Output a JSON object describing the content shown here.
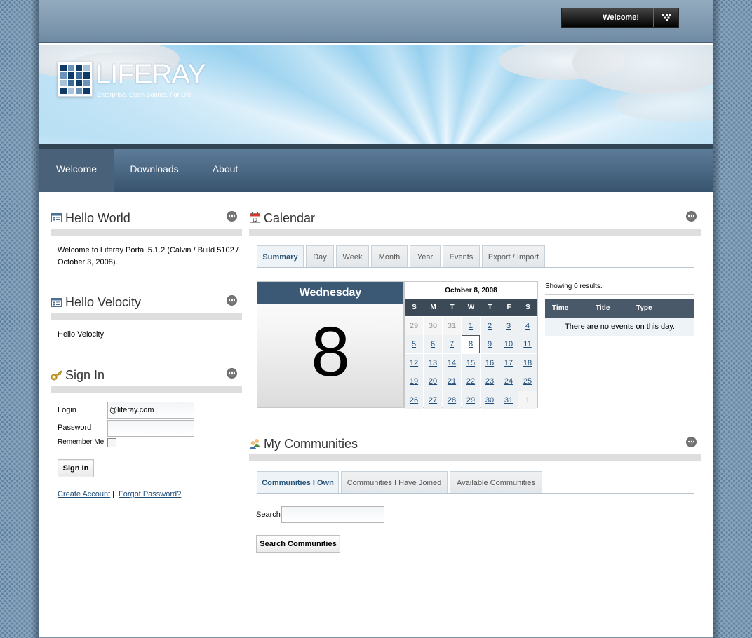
{
  "dock": {
    "welcome": "Welcome!"
  },
  "banner": {
    "logo_text": "LIFERAY",
    "tagline": "Enterprise. Open Source. For Life."
  },
  "nav": {
    "items": [
      "Welcome",
      "Downloads",
      "About"
    ],
    "selected": "Welcome"
  },
  "hello_world": {
    "title": "Hello World",
    "body": "Welcome to Liferay Portal 5.1.2 (Calvin / Build 5102 / October 3, 2008)."
  },
  "hello_velocity": {
    "title": "Hello Velocity",
    "body": "Hello Velocity"
  },
  "sign_in": {
    "title": "Sign In",
    "login_label": "Login",
    "login_value": "@liferay.com",
    "password_label": "Password",
    "password_value": "",
    "remember_label": "Remember Me",
    "remember_checked": false,
    "button": "Sign In",
    "create_account": "Create Account",
    "separator": "|",
    "forgot_password": "Forgot Password?"
  },
  "calendar": {
    "title": "Calendar",
    "tabs": [
      "Summary",
      "Day",
      "Week",
      "Month",
      "Year",
      "Events",
      "Export / Import"
    ],
    "active_tab": "Summary",
    "weekday": "Wednesday",
    "day_number": "8",
    "month_title": "October 8, 2008",
    "weekday_headers": [
      "S",
      "M",
      "T",
      "W",
      "T",
      "F",
      "S"
    ],
    "weeks": [
      [
        "29",
        "30",
        "31",
        "1",
        "2",
        "3",
        "4"
      ],
      [
        "5",
        "6",
        "7",
        "8",
        "9",
        "10",
        "11"
      ],
      [
        "12",
        "13",
        "14",
        "15",
        "16",
        "17",
        "18"
      ],
      [
        "19",
        "20",
        "21",
        "22",
        "23",
        "24",
        "25"
      ],
      [
        "26",
        "27",
        "28",
        "29",
        "30",
        "31",
        "1"
      ]
    ],
    "today": "8",
    "results": "Showing 0 results.",
    "columns": [
      "Time",
      "Title",
      "Type"
    ],
    "empty_message": "There are no events on this day."
  },
  "communities": {
    "title": "My Communities",
    "tabs": [
      "Communities I Own",
      "Communities I Have Joined",
      "Available Communities"
    ],
    "active_tab": "Communities I Own",
    "search_label": "Search",
    "search_value": "",
    "button": "Search Communities"
  },
  "colors": {
    "nav_bg": "#49627a",
    "calendar_header": "#3b5975",
    "link": "#1f4d7a",
    "tab_active_text": "#2b5679"
  }
}
